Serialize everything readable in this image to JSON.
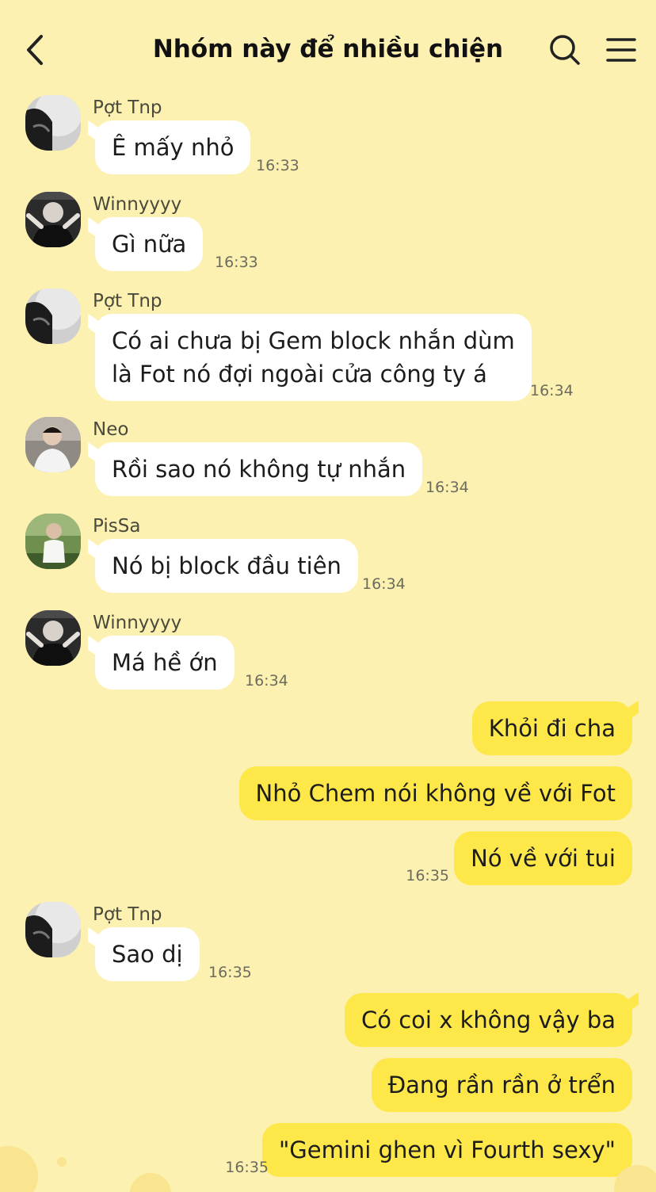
{
  "header": {
    "title": "Nhóm này để nhiều chiện",
    "back_icon": "chevron-left-icon",
    "search_icon": "search-icon",
    "menu_icon": "hamburger-menu-icon"
  },
  "colors": {
    "background": "#fdf1b1",
    "incoming_bubble": "#ffffff",
    "outgoing_bubble": "#fde749"
  },
  "messages": [
    {
      "sender": "Pợt Tnp",
      "text": "Ê mấy nhỏ",
      "time": "16:33"
    },
    {
      "sender": "Winnyyyy",
      "text": "Gì nữa",
      "time": "16:33"
    },
    {
      "sender": "Pợt Tnp",
      "text_line1": "Có ai chưa bị Gem block nhắn dùm",
      "text_line2": "là Fot nó đợi ngoài cửa công ty á",
      "time": "16:34"
    },
    {
      "sender": "Neo",
      "text": "Rồi sao nó không tự nhắn",
      "time": "16:34"
    },
    {
      "sender": "PisSa",
      "text": "Nó bị block đầu tiên",
      "time": "16:34"
    },
    {
      "sender": "Winnyyyy",
      "text": "Má hề ớn",
      "time": "16:34"
    },
    {
      "sender": "",
      "text": "Khỏi đi cha"
    },
    {
      "sender": "",
      "text": "Nhỏ Chem nói không về với Fot"
    },
    {
      "sender": "",
      "text": "Nó về với tui",
      "time": "16:35"
    },
    {
      "sender": "Pợt Tnp",
      "text": "Sao dị",
      "time": "16:35"
    },
    {
      "sender": "",
      "text": "Có coi x không vậy ba"
    },
    {
      "sender": "",
      "text": "Đang rần rần ở trển"
    },
    {
      "sender": "",
      "text": "\"Gemini ghen vì Fourth sexy\"",
      "time": "16:35"
    }
  ]
}
